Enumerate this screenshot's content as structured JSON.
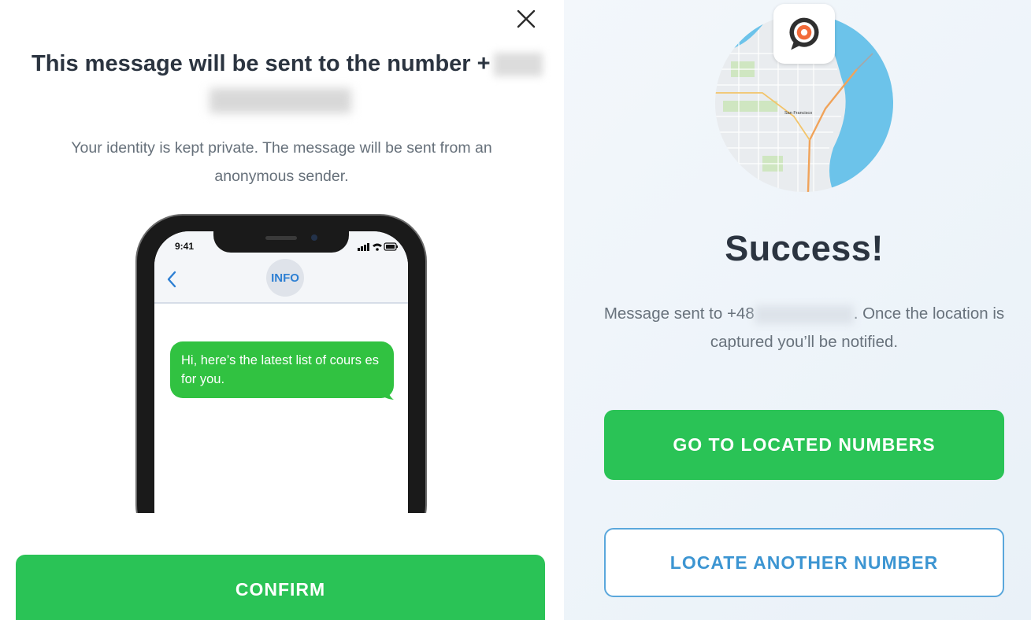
{
  "left": {
    "title": "This message will be sent to the number +",
    "subtitle": "Your identity is kept private. The message will be sent from an anonymous sender.",
    "confirm_label": "CONFIRM",
    "close_icon": "close-icon",
    "phone": {
      "time": "9:41",
      "contact": "INFO",
      "message": "Hi, here’s the latest list of cours es for you."
    }
  },
  "right": {
    "logo_icon": "location-pin-logo",
    "map_label": "San Francisco",
    "success_title": "Success!",
    "message_prefix": "Message sent to +48",
    "message_suffix": ". Once the location is captured you’ll be notified.",
    "go_button": "GO TO LOCATED NUMBERS",
    "locate_button": "LOCATE ANOTHER NUMBER"
  },
  "colors": {
    "green": "#2ac356",
    "bubble_green": "#31c241",
    "blue_outline": "#5aa7dc",
    "title_text": "#2b3440",
    "body_text": "#66707a"
  }
}
